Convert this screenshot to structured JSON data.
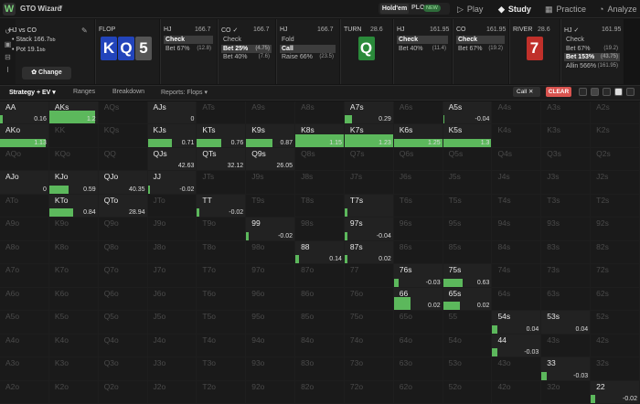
{
  "topbar": {
    "logo": "W",
    "app_name": "GTO Wizard",
    "app_chevron": "∨",
    "game_holdem": "Hold'em",
    "game_plo": "PLO",
    "plo_badge": "NEW",
    "nav": [
      {
        "id": "play",
        "icon": "▷",
        "label": "Play"
      },
      {
        "id": "study",
        "icon": "◆",
        "label": "Study"
      },
      {
        "id": "practice",
        "icon": "▦",
        "label": "Practice"
      },
      {
        "id": "analyze",
        "icon": "◔",
        "label": "Analyze"
      }
    ]
  },
  "left_icons": [
    {
      "name": "history-icon",
      "glyph": "↺"
    },
    {
      "name": "save-icon",
      "glyph": "▣"
    },
    {
      "name": "aggregate-icon",
      "glyph": "⊟"
    },
    {
      "name": "text-cursor-icon",
      "glyph": "I"
    }
  ],
  "spot": {
    "positions": "HJ vs CO",
    "stack_label": "Stack",
    "stack": "166.7",
    "stack_unit": "bb",
    "pot_label": "Pot",
    "pot": "19.1",
    "pot_unit": "bb",
    "change_label": "✿ Change"
  },
  "panels": [
    {
      "id": "flop",
      "header": "FLOP",
      "stack": "",
      "cards": [
        {
          "rank": "K",
          "color": "#2244bb"
        },
        {
          "rank": "Q",
          "color": "#2244bb"
        },
        {
          "rank": "5",
          "color": "#555555"
        }
      ],
      "actions": []
    },
    {
      "id": "hj1",
      "header": "HJ",
      "stack": "166.7",
      "cards": [],
      "actions": [
        {
          "label": "Check",
          "pct": "",
          "selected": true
        },
        {
          "label": "Bet 67%",
          "pct": "(12.8)",
          "selected": false
        }
      ]
    },
    {
      "id": "co1",
      "header": "CO ✓",
      "stack": "166.7",
      "cards": [],
      "actions": [
        {
          "label": "Check",
          "pct": "",
          "selected": false
        },
        {
          "label": "Bet 25%",
          "pct": "(4.75)",
          "selected": true
        },
        {
          "label": "Bet 40%",
          "pct": "(7.6)",
          "selected": false
        }
      ]
    },
    {
      "id": "hj2",
      "header": "HJ",
      "stack": "166.7",
      "cards": [],
      "actions": [
        {
          "label": "Fold",
          "pct": "",
          "selected": false
        },
        {
          "label": "Call",
          "pct": "",
          "selected": true
        },
        {
          "label": "Raise 66%",
          "pct": "(23.5)",
          "selected": false
        }
      ]
    },
    {
      "id": "turn",
      "header": "TURN",
      "stack": "28.6",
      "cards": [
        {
          "rank": "Q",
          "color": "#2a8a3a"
        }
      ],
      "actions": []
    },
    {
      "id": "hj3",
      "header": "HJ",
      "stack": "161.95",
      "cards": [],
      "actions": [
        {
          "label": "Check",
          "pct": "",
          "selected": true
        },
        {
          "label": "Bet 40%",
          "pct": "(11.4)",
          "selected": false
        }
      ]
    },
    {
      "id": "co2",
      "header": "CO",
      "stack": "161.95",
      "cards": [],
      "actions": [
        {
          "label": "Check",
          "pct": "",
          "selected": true
        },
        {
          "label": "Bet 67%",
          "pct": "(19.2)",
          "selected": false
        }
      ]
    },
    {
      "id": "river",
      "header": "RIVER",
      "stack": "28.6",
      "cards": [
        {
          "rank": "7",
          "color": "#c0302a"
        }
      ],
      "actions": []
    },
    {
      "id": "hj4",
      "header": "HJ ✓",
      "stack": "161.95",
      "cards": [],
      "actions": [
        {
          "label": "Check",
          "pct": "",
          "selected": false
        },
        {
          "label": "Bet 67%",
          "pct": "(19.2)",
          "selected": false
        },
        {
          "label": "Bet 153%",
          "pct": "(43.75)",
          "selected": true
        },
        {
          "label": "Allin 566%",
          "pct": "(161.95)",
          "selected": false
        }
      ]
    }
  ],
  "subbar": {
    "tabs": [
      "Strategy + EV ▾",
      "Ranges",
      "Breakdown",
      "Reports: Flops ▾"
    ],
    "filter_chip": "Call ✕",
    "clear": "CLEAR"
  },
  "grid": {
    "cols": 13,
    "rows": 13,
    "hands": [
      [
        "AA",
        "AKs",
        "AQs",
        "AJs",
        "ATs",
        "A9s",
        "A8s",
        "A7s",
        "A6s",
        "A5s",
        "A4s",
        "A3s",
        "A2s"
      ],
      [
        "AKo",
        "KK",
        "KQs",
        "KJs",
        "KTs",
        "K9s",
        "K8s",
        "K7s",
        "K6s",
        "K5s",
        "K4s",
        "K3s",
        "K2s"
      ],
      [
        "AQo",
        "KQo",
        "QQ",
        "QJs",
        "QTs",
        "Q9s",
        "Q8s",
        "Q7s",
        "Q6s",
        "Q5s",
        "Q4s",
        "Q3s",
        "Q2s"
      ],
      [
        "AJo",
        "KJo",
        "QJo",
        "JJ",
        "JTs",
        "J9s",
        "J8s",
        "J7s",
        "J6s",
        "J5s",
        "J4s",
        "J3s",
        "J2s"
      ],
      [
        "ATo",
        "KTo",
        "QTo",
        "JTo",
        "TT",
        "T9s",
        "T8s",
        "T7s",
        "T6s",
        "T5s",
        "T4s",
        "T3s",
        "T2s"
      ],
      [
        "A9o",
        "K9o",
        "Q9o",
        "J9o",
        "T9o",
        "99",
        "98s",
        "97s",
        "96s",
        "95s",
        "94s",
        "93s",
        "92s"
      ],
      [
        "A8o",
        "K8o",
        "Q8o",
        "J8o",
        "T8o",
        "98o",
        "88",
        "87s",
        "86s",
        "85s",
        "84s",
        "83s",
        "82s"
      ],
      [
        "A7o",
        "K7o",
        "Q7o",
        "J7o",
        "T7o",
        "97o",
        "87o",
        "77",
        "76s",
        "75s",
        "74s",
        "73s",
        "72s"
      ],
      [
        "A6o",
        "K6o",
        "Q6o",
        "J6o",
        "T6o",
        "96o",
        "86o",
        "76o",
        "66",
        "65s",
        "64s",
        "63s",
        "62s"
      ],
      [
        "A5o",
        "K5o",
        "Q5o",
        "J5o",
        "T5o",
        "95o",
        "85o",
        "75o",
        "65o",
        "55",
        "54s",
        "53s",
        "52s"
      ],
      [
        "A4o",
        "K4o",
        "Q4o",
        "J4o",
        "T4o",
        "94o",
        "84o",
        "74o",
        "64o",
        "54o",
        "44",
        "43s",
        "42s"
      ],
      [
        "A3o",
        "K3o",
        "Q3o",
        "J3o",
        "T3o",
        "93o",
        "83o",
        "73o",
        "63o",
        "53o",
        "43o",
        "33",
        "32s"
      ],
      [
        "A2o",
        "K2o",
        "Q2o",
        "J2o",
        "T2o",
        "92o",
        "82o",
        "72o",
        "62o",
        "52o",
        "42o",
        "32o",
        "22"
      ]
    ],
    "active": [
      {
        "r": 0,
        "c": 0,
        "ev": "0.16",
        "bar": 0.05
      },
      {
        "r": 0,
        "c": 1,
        "ev": "1.2",
        "bar": 0.95,
        "tall": true
      },
      {
        "r": 0,
        "c": 3,
        "ev": "0",
        "bar": 0
      },
      {
        "r": 0,
        "c": 7,
        "ev": "0.29",
        "bar": 0.15
      },
      {
        "r": 0,
        "c": 9,
        "ev": "-0.04",
        "bar": 0.03
      },
      {
        "r": 1,
        "c": 0,
        "ev": "1.13",
        "bar": 0.95
      },
      {
        "r": 1,
        "c": 3,
        "ev": "0.71",
        "bar": 0.5
      },
      {
        "r": 1,
        "c": 4,
        "ev": "0.76",
        "bar": 0.5
      },
      {
        "r": 1,
        "c": 5,
        "ev": "0.87",
        "bar": 0.55
      },
      {
        "r": 1,
        "c": 6,
        "ev": "1.15",
        "bar": 1,
        "tall": true
      },
      {
        "r": 1,
        "c": 7,
        "ev": "1.23",
        "bar": 1,
        "tall": true
      },
      {
        "r": 1,
        "c": 8,
        "ev": "1.25",
        "bar": 1
      },
      {
        "r": 1,
        "c": 9,
        "ev": "1.3",
        "bar": 1
      },
      {
        "r": 2,
        "c": 3,
        "ev": "42.63",
        "bar": 0
      },
      {
        "r": 2,
        "c": 4,
        "ev": "32.12",
        "bar": 0
      },
      {
        "r": 2,
        "c": 5,
        "ev": "26.05",
        "bar": 0
      },
      {
        "r": 3,
        "c": 0,
        "ev": "0",
        "bar": 0
      },
      {
        "r": 3,
        "c": 1,
        "ev": "0.59",
        "bar": 0.4
      },
      {
        "r": 3,
        "c": 2,
        "ev": "40.35",
        "bar": 0
      },
      {
        "r": 3,
        "c": 3,
        "ev": "-0.02",
        "bar": 0.05
      },
      {
        "r": 4,
        "c": 1,
        "ev": "0.84",
        "bar": 0.5
      },
      {
        "r": 4,
        "c": 2,
        "ev": "28.94",
        "bar": 0
      },
      {
        "r": 4,
        "c": 4,
        "ev": "-0.02",
        "bar": 0.05
      },
      {
        "r": 4,
        "c": 7,
        "ev": "",
        "bar": 0.05
      },
      {
        "r": 5,
        "c": 5,
        "ev": "-0.02",
        "bar": 0.05
      },
      {
        "r": 5,
        "c": 7,
        "ev": "-0.04",
        "bar": 0.05
      },
      {
        "r": 6,
        "c": 6,
        "ev": "0.14",
        "bar": 0.08
      },
      {
        "r": 6,
        "c": 7,
        "ev": "0.02",
        "bar": 0.05
      },
      {
        "r": 7,
        "c": 8,
        "ev": "-0.03",
        "bar": 0.1
      },
      {
        "r": 7,
        "c": 9,
        "ev": "0.63",
        "bar": 0.4
      },
      {
        "r": 8,
        "c": 8,
        "ev": "0.02",
        "bar": 0.35,
        "tall": true
      },
      {
        "r": 8,
        "c": 9,
        "ev": "0.02",
        "bar": 0.35
      },
      {
        "r": 9,
        "c": 10,
        "ev": "0.04",
        "bar": 0.1
      },
      {
        "r": 9,
        "c": 11,
        "ev": "0.04",
        "bar": 0
      },
      {
        "r": 10,
        "c": 10,
        "ev": "-0.03",
        "bar": 0.1
      },
      {
        "r": 11,
        "c": 11,
        "ev": "-0.03",
        "bar": 0.1
      },
      {
        "r": 12,
        "c": 12,
        "ev": "-0.02",
        "bar": 0.1
      }
    ]
  }
}
